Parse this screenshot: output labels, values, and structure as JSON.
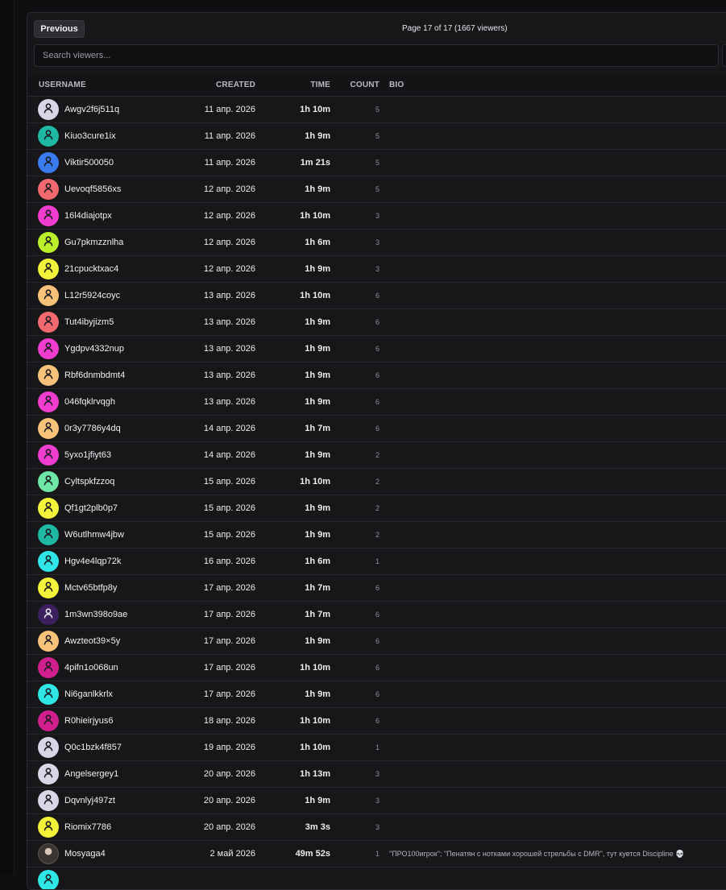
{
  "pagination": {
    "previous_label": "Previous",
    "page_info": "Page 17 of 17 (1667 viewers)"
  },
  "search": {
    "placeholder": "Search viewers..."
  },
  "columns": {
    "username": "USERNAME",
    "created": "CREATED",
    "time": "TIME",
    "count": "COUNT",
    "bio": "BIO"
  },
  "icons": {
    "avatar": "user-icon"
  },
  "rows": [
    {
      "username": "Awgv2f6j511q",
      "created": "11 апр. 2026",
      "time": "1h 10m",
      "count": "5",
      "bio": "",
      "avatar_color": "#d7d7e6"
    },
    {
      "username": "Kiuo3cure1ix",
      "created": "11 апр. 2026",
      "time": "1h 9m",
      "count": "5",
      "bio": "",
      "avatar_color": "#1fb8a2"
    },
    {
      "username": "Viktir500050",
      "created": "11 апр. 2026",
      "time": "1m 21s",
      "count": "5",
      "bio": "",
      "avatar_color": "#3a7bf0"
    },
    {
      "username": "Uevoqf5856xs",
      "created": "12 апр. 2026",
      "time": "1h 9m",
      "count": "5",
      "bio": "",
      "avatar_color": "#f26a6f"
    },
    {
      "username": "16l4diajotpx",
      "created": "12 апр. 2026",
      "time": "1h 10m",
      "count": "3",
      "bio": "",
      "avatar_color": "#f03ccf"
    },
    {
      "username": "Gu7pkmzznlha",
      "created": "12 апр. 2026",
      "time": "1h 6m",
      "count": "3",
      "bio": "",
      "avatar_color": "#b9f02a"
    },
    {
      "username": "21cpucktxac4",
      "created": "12 апр. 2026",
      "time": "1h 9m",
      "count": "3",
      "bio": "",
      "avatar_color": "#f2f23a"
    },
    {
      "username": "L12r5924coyc",
      "created": "13 апр. 2026",
      "time": "1h 10m",
      "count": "6",
      "bio": "",
      "avatar_color": "#f6c27a"
    },
    {
      "username": "Tut4ibyjizm5",
      "created": "13 апр. 2026",
      "time": "1h 9m",
      "count": "6",
      "bio": "",
      "avatar_color": "#f26a6f"
    },
    {
      "username": "Ygdpv4332nup",
      "created": "13 апр. 2026",
      "time": "1h 9m",
      "count": "6",
      "bio": "",
      "avatar_color": "#f03ccf"
    },
    {
      "username": "Rbf6dnmbdmt4",
      "created": "13 апр. 2026",
      "time": "1h 9m",
      "count": "6",
      "bio": "",
      "avatar_color": "#f6c27a"
    },
    {
      "username": "046fqklrvqgh",
      "created": "13 апр. 2026",
      "time": "1h 9m",
      "count": "6",
      "bio": "",
      "avatar_color": "#f03ccf"
    },
    {
      "username": "0r3y7786y4dq",
      "created": "14 апр. 2026",
      "time": "1h 7m",
      "count": "6",
      "bio": "",
      "avatar_color": "#f6c27a"
    },
    {
      "username": "5yxo1jfiyt63",
      "created": "14 апр. 2026",
      "time": "1h 9m",
      "count": "2",
      "bio": "",
      "avatar_color": "#f03ccf"
    },
    {
      "username": "Cyltspkfzzoq",
      "created": "15 апр. 2026",
      "time": "1h 10m",
      "count": "2",
      "bio": "",
      "avatar_color": "#6ee6a6"
    },
    {
      "username": "Qf1gt2plb0p7",
      "created": "15 апр. 2026",
      "time": "1h 9m",
      "count": "2",
      "bio": "",
      "avatar_color": "#f2f23a"
    },
    {
      "username": "W6utlhmw4jbw",
      "created": "15 апр. 2026",
      "time": "1h 9m",
      "count": "2",
      "bio": "",
      "avatar_color": "#1fb8a2"
    },
    {
      "username": "Hgv4e4lqp72k",
      "created": "16 апр. 2026",
      "time": "1h 6m",
      "count": "1",
      "bio": "",
      "avatar_color": "#2fe6e6"
    },
    {
      "username": "Mctv65btfp8y",
      "created": "17 апр. 2026",
      "time": "1h 7m",
      "count": "6",
      "bio": "",
      "avatar_color": "#f2f23a"
    },
    {
      "username": "1m3wn398o9ae",
      "created": "17 апр. 2026",
      "time": "1h 7m",
      "count": "6",
      "bio": "",
      "avatar_color": "#3b1f5e"
    },
    {
      "username": "Awzteot39×5y",
      "created": "17 апр. 2026",
      "time": "1h 9m",
      "count": "6",
      "bio": "",
      "avatar_color": "#f6c27a"
    },
    {
      "username": "4pifn1o068un",
      "created": "17 апр. 2026",
      "time": "1h 10m",
      "count": "6",
      "bio": "",
      "avatar_color": "#d11f8f"
    },
    {
      "username": "Ni6ganlkkrlx",
      "created": "17 апр. 2026",
      "time": "1h 9m",
      "count": "6",
      "bio": "",
      "avatar_color": "#2fe6e6"
    },
    {
      "username": "R0hieirjyus6",
      "created": "18 апр. 2026",
      "time": "1h 10m",
      "count": "6",
      "bio": "",
      "avatar_color": "#d11f8f"
    },
    {
      "username": "Q0c1bzk4f857",
      "created": "19 апр. 2026",
      "time": "1h 10m",
      "count": "1",
      "bio": "",
      "avatar_color": "#d7d7e6"
    },
    {
      "username": "Angelsergey1",
      "created": "20 апр. 2026",
      "time": "1h 13m",
      "count": "3",
      "bio": "",
      "avatar_color": "#d7d7e6"
    },
    {
      "username": "Dqvnlyj497zt",
      "created": "20 апр. 2026",
      "time": "1h 9m",
      "count": "3",
      "bio": "",
      "avatar_color": "#d7d7e6"
    },
    {
      "username": "Riomix7786",
      "created": "20 апр. 2026",
      "time": "3m 3s",
      "count": "3",
      "bio": "",
      "avatar_color": "#f2f23a"
    },
    {
      "username": "Mosyaga4",
      "created": "2 май 2026",
      "time": "49m 52s",
      "count": "1",
      "bio": "\"ПРО100игрок\"; \"Пенатян с нотками хорошей стрельбы с DMR\", тут куется Discipline 💀",
      "avatar_color": "photo"
    },
    {
      "username": "",
      "created": "",
      "time": "",
      "count": "",
      "bio": "",
      "avatar_color": "#2fe6e6"
    }
  ]
}
